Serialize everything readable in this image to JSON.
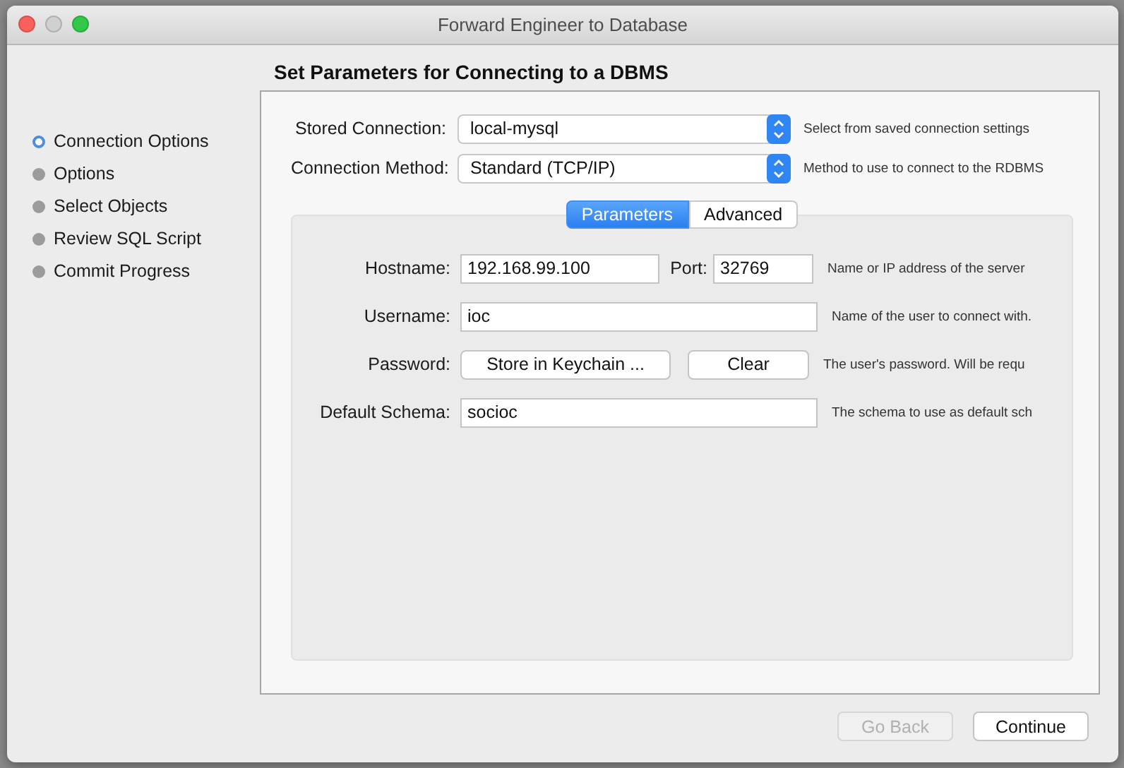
{
  "window": {
    "title": "Forward Engineer to Database"
  },
  "steps": [
    {
      "label": "Connection Options",
      "selected": true
    },
    {
      "label": "Options",
      "selected": false
    },
    {
      "label": "Select Objects",
      "selected": false
    },
    {
      "label": "Review SQL Script",
      "selected": false
    },
    {
      "label": "Commit Progress",
      "selected": false
    }
  ],
  "heading": "Set Parameters for Connecting to a DBMS",
  "connection": [
    {
      "label": "Stored Connection:",
      "value": "local-mysql",
      "hint": "Select from saved connection settings"
    },
    {
      "label": "Connection Method:",
      "value": "Standard (TCP/IP)",
      "hint": "Method to use to connect to the RDBMS"
    }
  ],
  "tabs": [
    {
      "label": "Parameters",
      "selected": true
    },
    {
      "label": "Advanced",
      "selected": false
    }
  ],
  "parameters": [
    {
      "kind": "host",
      "label": "Hostname:",
      "value": "192.168.99.100",
      "port_label": "Port:",
      "port": "32769",
      "hint": "Name or IP address of the server"
    },
    {
      "kind": "field",
      "label": "Username:",
      "value": "ioc",
      "hint": "Name of the user to connect with."
    },
    {
      "kind": "buttons",
      "label": "Password:",
      "buttons": [
        "Store in Keychain ...",
        "Clear"
      ],
      "hint": "The user's password. Will be requ"
    },
    {
      "kind": "field",
      "label": "Default Schema:",
      "value": "socioc",
      "hint": "The schema to use as default sch"
    }
  ],
  "footer": [
    {
      "label": "Go Back",
      "disabled": true
    },
    {
      "label": "Continue",
      "disabled": false
    }
  ]
}
